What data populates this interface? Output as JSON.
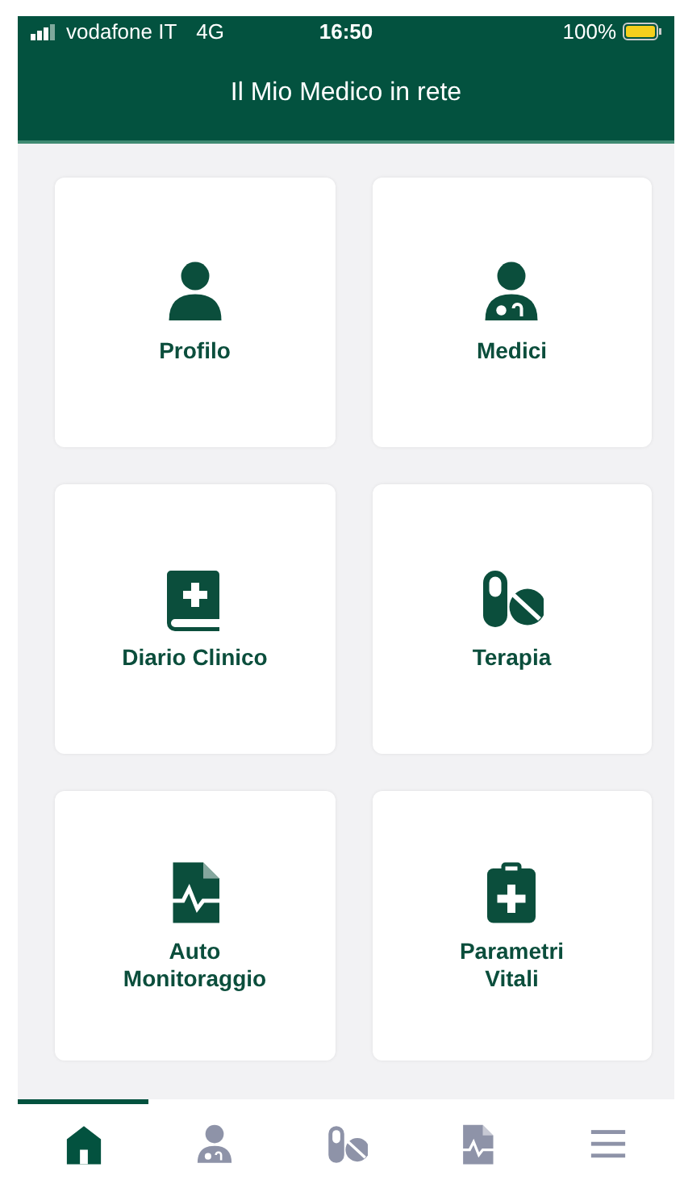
{
  "status_bar": {
    "carrier": "vodafone IT",
    "network": "4G",
    "time": "16:50",
    "battery": "100%"
  },
  "header": {
    "title": "Il Mio Medico in rete"
  },
  "tiles": [
    {
      "label": "Profilo"
    },
    {
      "label": "Medici"
    },
    {
      "label": "Diario Clinico"
    },
    {
      "label": "Terapia"
    },
    {
      "label": "Auto Monitoraggio"
    },
    {
      "label": "Parametri Vitali"
    }
  ],
  "tab_bar": [
    {
      "selected": true
    },
    {
      "selected": false
    },
    {
      "selected": false
    },
    {
      "selected": false
    },
    {
      "selected": false
    }
  ]
}
